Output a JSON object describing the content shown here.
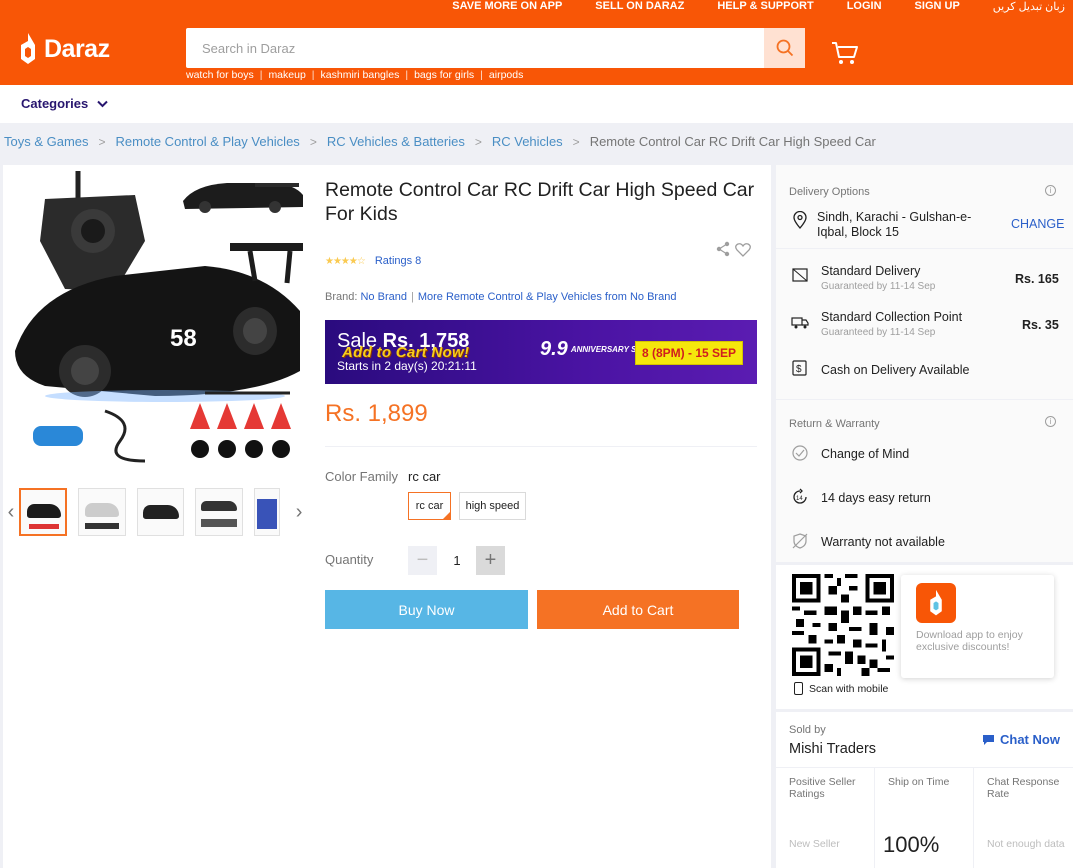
{
  "header": {
    "top_links": [
      "SAVE MORE ON APP",
      "SELL ON DARAZ",
      "HELP & SUPPORT",
      "LOGIN",
      "SIGN UP",
      "زبان تبدیل کریں"
    ],
    "logo_text": "Daraz",
    "search_placeholder": "Search in Daraz",
    "keywords": [
      "watch for boys",
      "makeup",
      "kashmiri bangles",
      "bags for girls",
      "airpods"
    ],
    "brand_color": "#f85606"
  },
  "categories": {
    "label": "Categories"
  },
  "breadcrumb": [
    "Toys & Games",
    "Remote Control & Play Vehicles",
    "RC Vehicles & Batteries",
    "RC Vehicles"
  ],
  "breadcrumb_current": "Remote Control Car RC Drift Car High Speed Car",
  "product": {
    "title": "Remote Control Car RC Drift Car High Speed Car For Kids",
    "stars": "★★★★☆",
    "ratings_text": "Ratings 8",
    "brand_label": "Brand:",
    "brand_name": "No Brand",
    "brand_more": "More Remote Control & Play Vehicles from No Brand",
    "sale": {
      "label": "Sale",
      "price": "Rs. 1,758",
      "overlay": "Add to Cart Now!",
      "starts": "Starts in 2 day(s) 20:21:11",
      "campaign": "9.9",
      "campaign_small": "ANNIVERSARY SALE",
      "dates": "8 (8PM) - 15 SEP"
    },
    "price": "Rs. 1,899",
    "color_family_label": "Color Family",
    "color_family_value": "rc car",
    "color_options": [
      "rc car",
      "high speed"
    ],
    "quantity_label": "Quantity",
    "quantity": "1",
    "qty_minus": "−",
    "qty_plus": "+",
    "buy_now": "Buy Now",
    "add_to_cart": "Add to Cart"
  },
  "delivery": {
    "title": "Delivery Options",
    "location": "Sindh, Karachi - Gulshan-e-Iqbal, Block 15",
    "change": "CHANGE",
    "standard": {
      "label": "Standard Delivery",
      "sub": "Guaranteed by 11-14 Sep",
      "price": "Rs. 165"
    },
    "collection": {
      "label": "Standard Collection Point",
      "sub": "Guaranteed by 11-14 Sep",
      "price": "Rs. 35"
    },
    "cod": "Cash on Delivery Available"
  },
  "warranty": {
    "title": "Return & Warranty",
    "items": [
      "Change of Mind",
      "14 days easy return",
      "Warranty not available"
    ]
  },
  "app_promo": {
    "scan_text": "Scan with mobile",
    "download_text": "Download app to enjoy exclusive discounts!"
  },
  "seller": {
    "sold_by": "Sold by",
    "name": "Mishi Traders",
    "chat": "Chat Now",
    "metrics": [
      {
        "label": "Positive Seller Ratings",
        "value": "New Seller"
      },
      {
        "label": "Ship on Time",
        "value": "100%"
      },
      {
        "label": "Chat Response Rate",
        "value": "Not enough data"
      }
    ]
  }
}
